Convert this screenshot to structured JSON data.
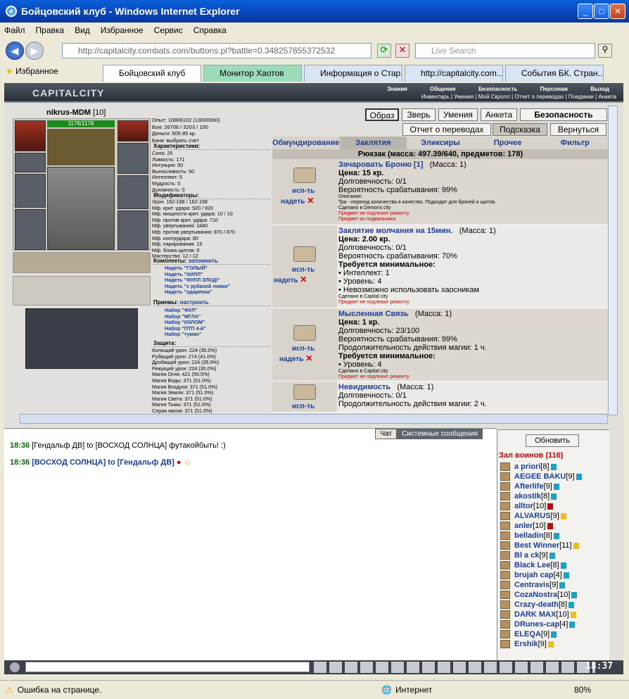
{
  "window": {
    "title": "Бойцовский клуб - Windows Internet Explorer"
  },
  "menu": [
    "Файл",
    "Правка",
    "Вид",
    "Избранное",
    "Сервис",
    "Справка"
  ],
  "address": "http://capitalcity.combats.com/buttons.pl?battle=0.348257655372532",
  "search_placeholder": "Live Search",
  "favorites_label": "Избранное",
  "tabs": [
    {
      "label": "Бойцовский клуб",
      "state": "active"
    },
    {
      "label": "Монитор Хаотов",
      "state": "green"
    },
    {
      "label": "Информация о Стар...",
      "state": "normal"
    },
    {
      "label": "http://capitalcity.com...",
      "state": "normal"
    },
    {
      "label": "События БК. Стран...",
      "state": "normal"
    }
  ],
  "city": {
    "logo": "CAPITALCITY",
    "nav_top": [
      "Знания",
      "Общение",
      "Безопасность",
      "Персонаж",
      "Выход"
    ],
    "nav_bottom": "Инвентарь | Умения | Мой Скролл | Отчет о переводах | Поединки | Анкета"
  },
  "character": {
    "name": "nikrus-MDM",
    "level": "[10]",
    "hp": "1176/1176",
    "exp_line": "Опыт: 10806102 (13000000)",
    "battles_line": "Боя: 26706 / 3203 / 100",
    "money_line": "Деньги: 505.85 кр.",
    "bank_line": "Банк: выбрать счет"
  },
  "buttons": {
    "obraz": "Образ",
    "zver": "Зверь",
    "umeniya": "Умения",
    "anketa": "Анкета",
    "bezopasnost": "Безопасность",
    "otchet": "Отчет о переводах",
    "podskazka": "Подсказка",
    "vernutsya": "Вернуться"
  },
  "sections": {
    "characteristics": "Характеристики:",
    "modifiers": "Модификаторы:",
    "kits": "Комплекты:",
    "kits_remember": "запомнить",
    "techniques": "Приемы:",
    "techniques_setup": "настроить",
    "protection": "Защита:"
  },
  "stats": [
    "Сила: 25",
    "Ловкость: 171",
    "Интуиция: 50",
    "Выносливость: 50",
    "Интеллект: 5",
    "Мудрость: 0",
    "Духовность: 0"
  ],
  "modifiers": [
    "Урон: 162-198 / 162-198",
    "Мф. крит. удара: 920 / 920",
    "Мф. мощности крит. удара: 10 / 10",
    "Мф. против крит. удара: 710",
    "Мф. увертывания: 1840",
    "Мф. против увертывания: 870 / 870",
    "Мф. контрудара: 80",
    "Мф. парирования: 15",
    "Мф. блока щитом: 0",
    "Мастерство: 12 / 12"
  ],
  "kits": [
    "Надеть \"ГОЛЫЙ\"",
    "Надеть \"ХИЛЛ\"",
    "Надеть \"ФУЛЛ ЗЛОДІ\"",
    "Надеть \"с рубахой ловки\"",
    "Надеть \"одарёнка\""
  ],
  "techniques": [
    "Набор \"ФУЛ\"",
    "Набор \"МГЛА\"",
    "Набор \"ИЗЛОМ\"",
    "Набор \"ПТП 4-й\"",
    "Набор \"туман\""
  ],
  "protection": [
    "Колющий урон: 224 (35.0%)",
    "Рубящий урон: 274 (41.0%)",
    "Дробящий урон: 224 (35.0%)",
    "Режущий урон: 224 (35.0%)",
    "Магия Огня: 421 (55.5%)",
    "Магия Воды: 371 (51.0%)",
    "Магия Воздуха: 371 (51.0%)",
    "Магия Земли: 371 (51.0%)",
    "Магия Света: 371 (51.0%)",
    "Магия Тьмы: 371 (51.0%)",
    "Серая магия: 371 (51.0%)"
  ],
  "inv_tabs": [
    "Обмундирование",
    "Заклятия",
    "Эликсиры",
    "Прочее",
    "Фильтр"
  ],
  "rucksack": "Рюкзак (масса: 497.39/640, предметов: 178)",
  "items": [
    {
      "name": "Зачаровать Броню [1]",
      "mass": "(Масса: 1)",
      "lines": [
        "Цена: 15 кр.",
        "Долговечность: 0/1",
        "Вероятность срабатывания: 99%"
      ],
      "small": [
        "Описание:",
        "Три - переход количества в качество. Подходит для броней и щитов.",
        "Сделано в Demons city"
      ],
      "red": [
        "Предмет не подлежит ремонту",
        "Предмет из подвальника"
      ]
    },
    {
      "name": "Заклятие молчания на 15мин.",
      "mass": "(Масса: 1)",
      "lines": [
        "Цена: 2.00 кр.",
        "Долговечность: 0/1",
        "Вероятность срабатывания: 70%",
        "Требуется минимальное:",
        "• Интеллект: 1",
        "• Уровень: 4",
        "• Невозможно использовать хаосникам"
      ],
      "small": [
        "Сделано в Capital city"
      ],
      "red": [
        "Предмет не подлежит ремонту"
      ]
    },
    {
      "name": "Мысленная Связь",
      "mass": "(Масса: 1)",
      "lines": [
        "Цена: 1 кр.",
        "Долговечность: 23/100",
        "Вероятность срабатывания: 99%",
        "Продолжительность действия магии: 1 ч.",
        "Требуется минимальное:",
        "• Уровень: 4"
      ],
      "small": [
        "Сделано в Capital city"
      ],
      "red": [
        "Предмет не подлежит ремонту"
      ]
    },
    {
      "name": "Невидимость",
      "mass": "(Масса: 1)",
      "lines": [
        "Долговечность: 0/1",
        "Продолжительность действия магии: 2 ч."
      ],
      "small": [],
      "red": []
    }
  ],
  "item_actions": {
    "use": "исп-ть",
    "wear": "надеть"
  },
  "chat": {
    "tab_chat": "Чат",
    "tab_system": "Системные сообщения",
    "messages": [
      {
        "time": "18:36",
        "text": "[Гендальф ДВ] to [ВОСХОД СОЛНЦА] футакойбыть! :)"
      },
      {
        "time": "18:36",
        "text": "[ВОСХОД СОЛНЦА] to [Гендальф ДВ]"
      }
    ]
  },
  "users": {
    "refresh": "Обновить",
    "hall": "Зал воинов (116)",
    "list": [
      {
        "name": "a priori",
        "level": "[8]"
      },
      {
        "name": "AEGEE BAKU",
        "level": "[9]"
      },
      {
        "name": "Afterlife",
        "level": "[9]"
      },
      {
        "name": "akostik",
        "level": "[8]"
      },
      {
        "name": "alltor",
        "level": "[10]"
      },
      {
        "name": "ALVARUS",
        "level": "[9]"
      },
      {
        "name": "anler",
        "level": "[10]"
      },
      {
        "name": "belladin",
        "level": "[8]"
      },
      {
        "name": "Best Winner",
        "level": "[11]"
      },
      {
        "name": "Bl a ck",
        "level": "[9]"
      },
      {
        "name": "Black Lee",
        "level": "[8]"
      },
      {
        "name": "brujah cap",
        "level": "[4]"
      },
      {
        "name": "Centravis",
        "level": "[9]"
      },
      {
        "name": "CozaNostra",
        "level": "[10]"
      },
      {
        "name": "Crazy-death",
        "level": "[8]"
      },
      {
        "name": "DARK MAX",
        "level": "[10]"
      },
      {
        "name": "DRunes-cap",
        "level": "[4]"
      },
      {
        "name": "ELEQA",
        "level": "[9]"
      },
      {
        "name": "Ershik",
        "level": "[9]"
      }
    ]
  },
  "clock": "18:37",
  "status": {
    "error": "Ошибка на странице.",
    "zone": "Интернет",
    "zoom": "80%"
  }
}
